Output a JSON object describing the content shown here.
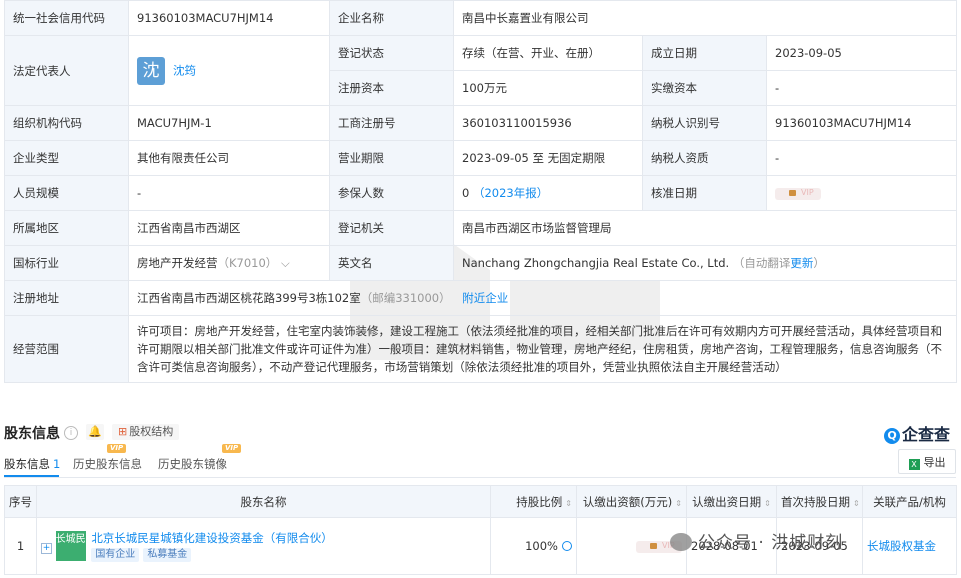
{
  "info": {
    "credit_code_label": "统一社会信用代码",
    "credit_code": "91360103MACU7HJM14",
    "company_name_label": "企业名称",
    "company_name": "南昌中长嘉置业有限公司",
    "legal_rep_label": "法定代表人",
    "legal_rep_avatar": "沈",
    "legal_rep": "沈筠",
    "reg_status_label": "登记状态",
    "reg_status": "存续（在营、开业、在册）",
    "founded_label": "成立日期",
    "founded": "2023-09-05",
    "reg_capital_label": "注册资本",
    "reg_capital": "100万元",
    "paid_capital_label": "实缴资本",
    "paid_capital": "-",
    "org_code_label": "组织机构代码",
    "org_code": "MACU7HJM-1",
    "biz_reg_no_label": "工商注册号",
    "biz_reg_no": "360103110015936",
    "taxpayer_id_label": "纳税人识别号",
    "taxpayer_id": "91360103MACU7HJM14",
    "company_type_label": "企业类型",
    "company_type": "其他有限责任公司",
    "term_label": "营业期限",
    "term": "2023-09-05 至 无固定期限",
    "taxpayer_qual_label": "纳税人资质",
    "taxpayer_qual": "-",
    "staff_size_label": "人员规模",
    "staff_size": "-",
    "insured_label": "参保人数",
    "insured": "0",
    "insured_year": "（2023年报）",
    "approval_date_label": "核准日期",
    "approval_vip": "VIP",
    "region_label": "所属地区",
    "region": "江西省南昌市西湖区",
    "reg_authority_label": "登记机关",
    "reg_authority": "南昌市西湖区市场监督管理局",
    "industry_label": "国标行业",
    "industry": "房地产开发经营",
    "industry_code": "（K7010）",
    "english_name_label": "英文名",
    "english_name": "Nanchang Zhongchangjia Real Estate Co., Ltd.",
    "auto_translate": "（自动翻译",
    "update": "更新",
    "auto_translate_close": "）",
    "address_label": "注册地址",
    "address": "江西省南昌市西湖区桃花路399号3栋102室",
    "postcode": "（邮编331000）",
    "nearby": "附近企业",
    "scope_label": "经营范围",
    "scope": "许可项目：房地产开发经营，住宅室内装饰装修，建设工程施工（依法须经批准的项目，经相关部门批准后在许可有效期内方可开展经营活动，具体经营项目和许可期限以相关部门批准文件或许可证件为准）一般项目：建筑材料销售，物业管理，房地产经纪，住房租赁，房地产咨询，工程管理服务，信息咨询服务（不含许可类信息咨询服务），不动产登记代理服务，市场营销策划（除依法须经批准的项目外，凭营业执照依法自主开展经营活动）"
  },
  "section": {
    "title": "股东信息",
    "info_icon": "i",
    "equity_structure": "股权结构",
    "brand": "企查查",
    "export": "导出"
  },
  "tabs": [
    {
      "label": "股东信息",
      "count": "1"
    },
    {
      "label": "历史股东信息",
      "vip": "VIP"
    },
    {
      "label": "历史股东镜像",
      "vip": "VIP"
    }
  ],
  "shareholders": {
    "columns": [
      "序号",
      "股东名称",
      "持股比例",
      "认缴出资额(万元)",
      "认缴出资日期",
      "首次持股日期",
      "关联产品/机构"
    ],
    "rows": [
      {
        "index": "1",
        "logo_text": "长城民星",
        "name": "北京长城民星城镇化建设投资基金（有限合伙）",
        "tags": [
          "国有企业",
          "私募基金"
        ],
        "ratio": "100%",
        "amount_vip": "VIP",
        "subscribe_date": "2028-08-01",
        "first_hold_date": "2023-09-05",
        "related": "长城股权基金"
      }
    ]
  },
  "watermark": "公众号 · 洪城财刻"
}
